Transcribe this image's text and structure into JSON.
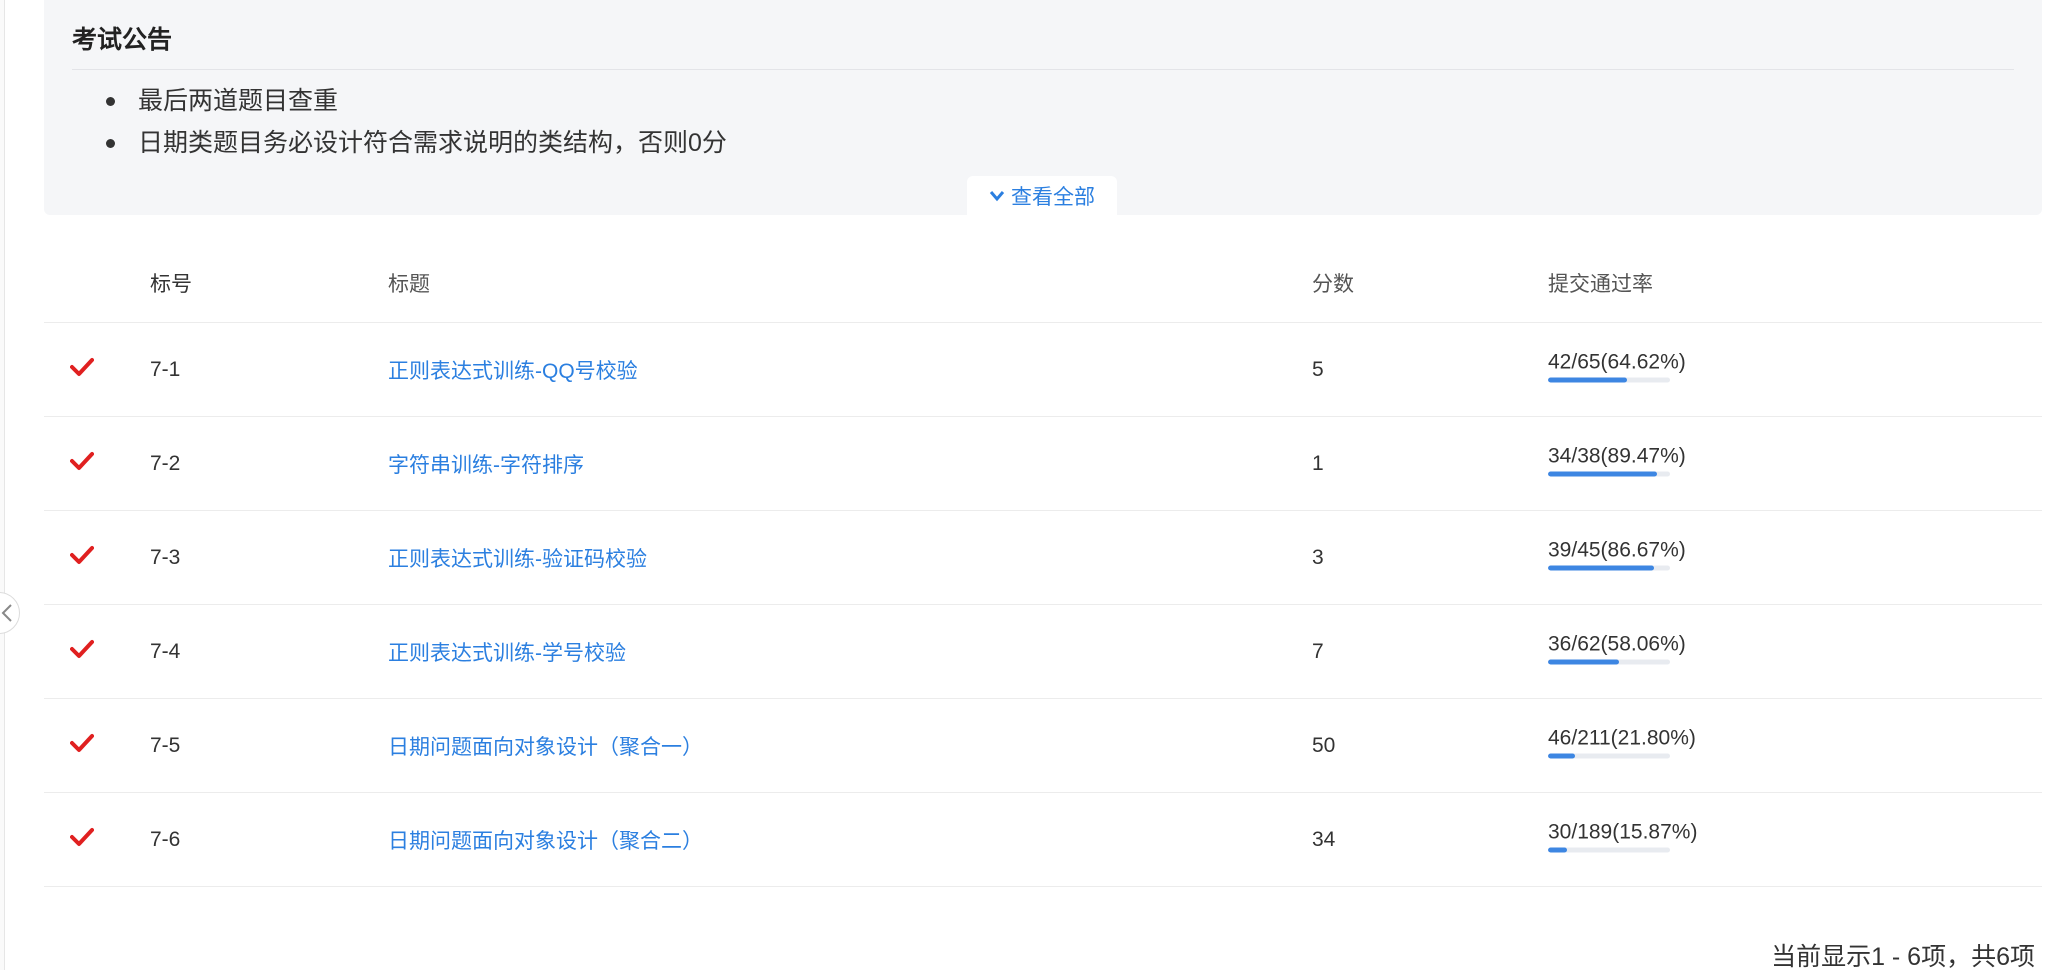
{
  "announcement": {
    "title": "考试公告",
    "items": [
      "最后两道题目查重",
      "日期类题目务必设计符合需求说明的类结构，否则0分"
    ],
    "view_all_label": "查看全部"
  },
  "table": {
    "headers": {
      "number": "标号",
      "title": "标题",
      "score": "分数",
      "pass_rate": "提交通过率"
    },
    "rows": [
      {
        "number": "7-1",
        "title": "正则表达式训练-QQ号校验",
        "score": "5",
        "rate_text": "42/65(64.62%)",
        "rate_pct": 64.62,
        "solved": true
      },
      {
        "number": "7-2",
        "title": "字符串训练-字符排序",
        "score": "1",
        "rate_text": "34/38(89.47%)",
        "rate_pct": 89.47,
        "solved": true
      },
      {
        "number": "7-3",
        "title": "正则表达式训练-验证码校验",
        "score": "3",
        "rate_text": "39/45(86.67%)",
        "rate_pct": 86.67,
        "solved": true
      },
      {
        "number": "7-4",
        "title": "正则表达式训练-学号校验",
        "score": "7",
        "rate_text": "36/62(58.06%)",
        "rate_pct": 58.06,
        "solved": true
      },
      {
        "number": "7-5",
        "title": "日期问题面向对象设计（聚合一）",
        "score": "50",
        "rate_text": "46/211(21.80%)",
        "rate_pct": 21.8,
        "solved": true
      },
      {
        "number": "7-6",
        "title": "日期问题面向对象设计（聚合二）",
        "score": "34",
        "rate_text": "30/189(15.87%)",
        "rate_pct": 15.87,
        "solved": true
      }
    ]
  },
  "footer": {
    "summary": "当前显示1 - 6项，共6项"
  },
  "colors": {
    "link": "#2b7fe0",
    "check": "#e02020",
    "bar_fill": "#3d86e2",
    "bar_track": "#e8ebf0",
    "announce_bg": "#f5f6f8"
  },
  "icons": {
    "solved": "check-icon",
    "view_all": "chevron-down-icon",
    "collapse": "chevron-left-icon"
  }
}
